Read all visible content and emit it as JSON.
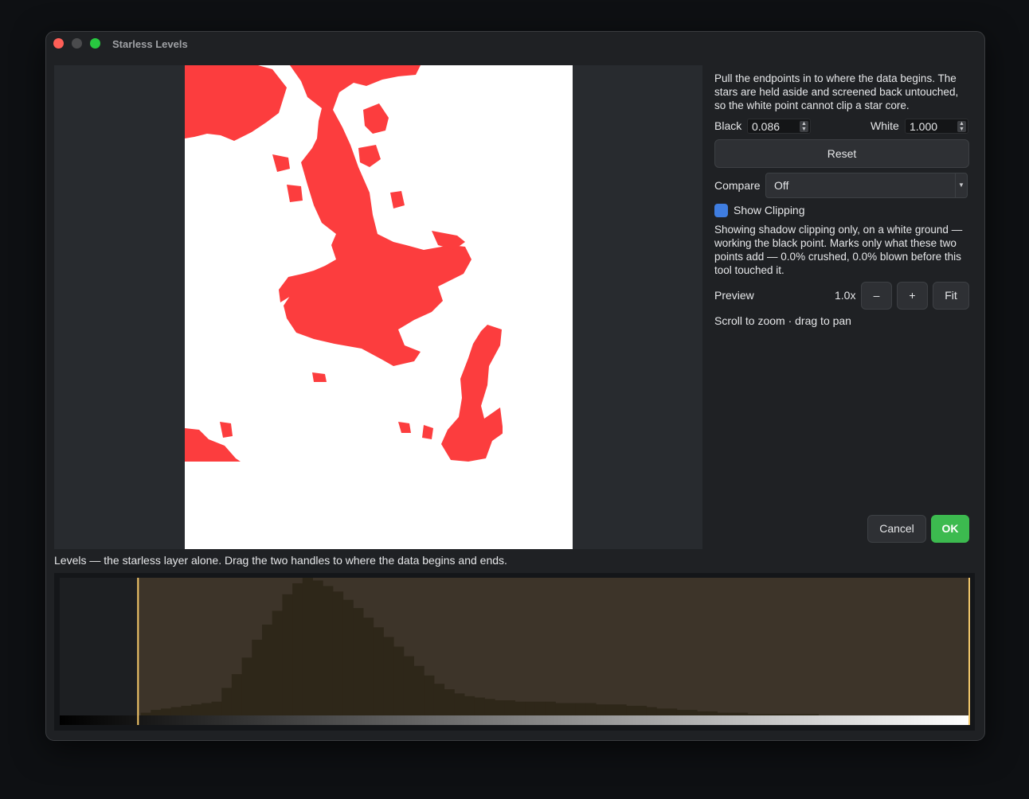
{
  "window": {
    "title": "Starless Levels"
  },
  "panel": {
    "description": "Pull the endpoints in to where the data begins. The stars are held aside and screened back untouched, so the white point cannot clip a star core.",
    "black_label": "Black",
    "black_value": "0.086",
    "white_label": "White",
    "white_value": "1.000",
    "reset_label": "Reset",
    "compare_label": "Compare",
    "compare_value": "Off",
    "show_clipping_label": "Show Clipping",
    "show_clipping_checked": true,
    "clipping_note": "Showing shadow clipping only, on a white ground — working the black point. Marks only what these two points add — 0.0% crushed, 0.0% blown before this tool touched it.",
    "preview_label": "Preview",
    "zoom_value": "1.0x",
    "zoom_out_label": "–",
    "zoom_in_label": "+",
    "fit_label": "Fit",
    "hint": "Scroll to zoom · drag to pan",
    "cancel_label": "Cancel",
    "ok_label": "OK"
  },
  "levels": {
    "label": "Levels — the starless layer alone. Drag the two handles to where the data begins and ends.",
    "black_point": 0.086,
    "white_point": 1.0,
    "histogram": [
      0,
      0,
      0,
      0,
      0,
      0,
      0,
      0,
      0.02,
      0.04,
      0.05,
      0.06,
      0.07,
      0.08,
      0.09,
      0.1,
      0.2,
      0.3,
      0.42,
      0.55,
      0.66,
      0.76,
      0.88,
      0.96,
      1.0,
      0.98,
      0.94,
      0.9,
      0.84,
      0.78,
      0.71,
      0.64,
      0.57,
      0.5,
      0.43,
      0.36,
      0.29,
      0.23,
      0.19,
      0.16,
      0.14,
      0.13,
      0.12,
      0.11,
      0.11,
      0.1,
      0.1,
      0.1,
      0.1,
      0.09,
      0.09,
      0.09,
      0.09,
      0.08,
      0.08,
      0.08,
      0.07,
      0.07,
      0.06,
      0.05,
      0.05,
      0.04,
      0.04,
      0.03,
      0.03,
      0.02,
      0.02,
      0.02,
      0.01,
      0.01,
      0.01,
      0.01,
      0.01,
      0.01,
      0.01,
      0.0,
      0.0,
      0.0,
      0.0,
      0.0,
      0.0,
      0.0,
      0.0,
      0.0,
      0.0,
      0.0,
      0.0,
      0.0,
      0.0,
      0.0
    ]
  },
  "colors": {
    "clip_mark": "#fc3d3e",
    "handle": "#f5c86a",
    "range_fill": "#3d3429",
    "histogram_bar": "#2e2719"
  }
}
